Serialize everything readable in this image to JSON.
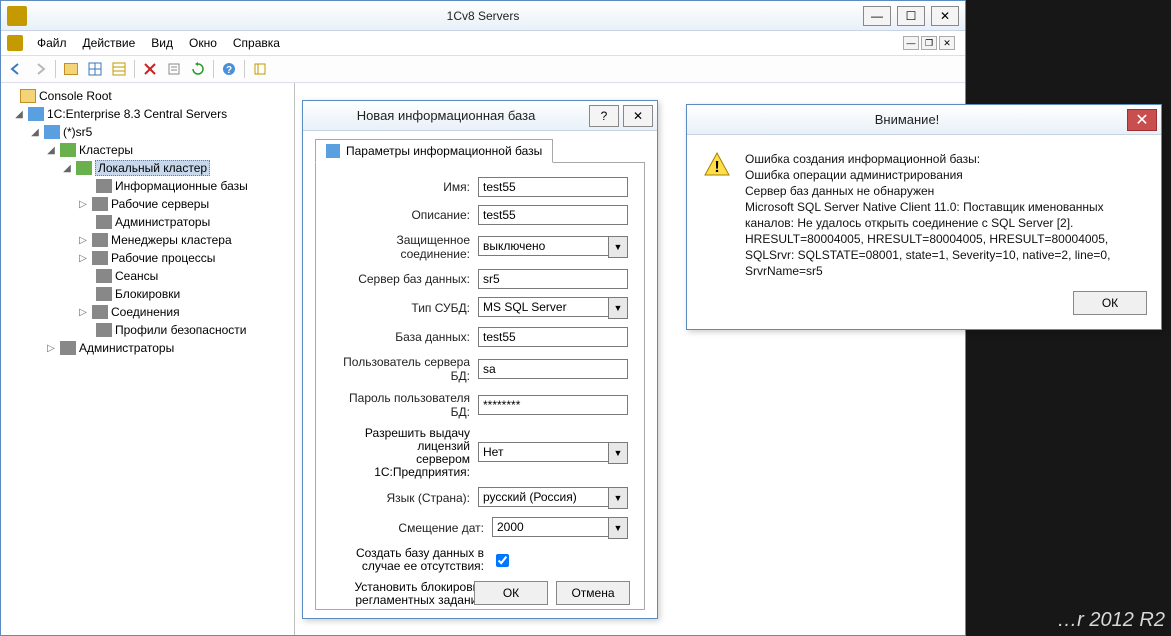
{
  "window": {
    "title": "1Cv8 Servers",
    "menu": [
      "Файл",
      "Действие",
      "Вид",
      "Окно",
      "Справка"
    ]
  },
  "tree": {
    "root": "Console Root",
    "srv": "1C:Enterprise 8.3 Central Servers",
    "sr5": "(*)sr5",
    "clusters": "Кластеры",
    "local_cluster": "Локальный кластер",
    "items": [
      "Информационные базы",
      "Рабочие серверы",
      "Администраторы",
      "Менеджеры кластера",
      "Рабочие процессы",
      "Сеансы",
      "Блокировки",
      "Соединения",
      "Профили безопасности"
    ],
    "admins": "Администраторы"
  },
  "dialog": {
    "title": "Новая информационная база",
    "tab": "Параметры информационной базы",
    "labels": {
      "name": "Имя:",
      "desc": "Описание:",
      "secure": "Защищенное соединение:",
      "dbserver": "Сервер баз данных:",
      "dbtype": "Тип СУБД:",
      "db": "База данных:",
      "dbuser": "Пользователь сервера БД:",
      "dbpass": "Пароль пользователя БД:",
      "lic1": "Разрешить выдачу лицензий",
      "lic2": "сервером 1С:Предприятия:",
      "lang": "Язык (Страна):",
      "dateoff": "Смещение дат:",
      "createdb1": "Создать базу данных в",
      "createdb2": "случае ее отсутствия:",
      "block1": "Установить блокировку",
      "block2": "регламентных заданий"
    },
    "values": {
      "name": "test55",
      "desc": "test55",
      "secure": "выключено",
      "dbserver": "sr5",
      "dbtype": "MS SQL Server",
      "db": "test55",
      "dbuser": "sa",
      "dbpass": "********",
      "lic": "Нет",
      "lang": "русский (Россия)",
      "dateoff": "2000"
    },
    "buttons": {
      "ok": "ОК",
      "cancel": "Отмена"
    }
  },
  "alert": {
    "title": "Внимание!",
    "lines": [
      "Ошибка создания информационной базы:",
      "Ошибка операции администрирования",
      "Сервер баз данных не обнаружен",
      "Microsoft SQL Server Native Client 11.0: Поставщик именованных каналов: Не удалось открыть соединение с SQL Server [2].",
      "HRESULT=80004005, HRESULT=80004005, HRESULT=80004005, SQLSrvr: SQLSTATE=08001, state=1, Severity=10, native=2, line=0, SrvrName=sr5"
    ],
    "ok": "ОК"
  },
  "watermark": "…r 2012 R2"
}
